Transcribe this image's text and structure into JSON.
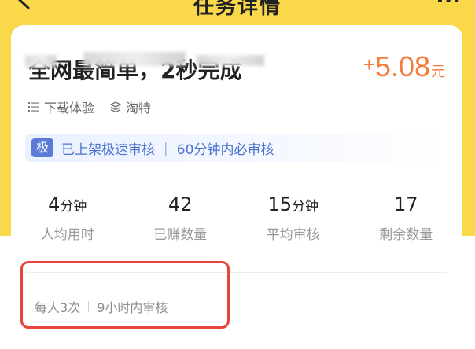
{
  "header": {
    "title": "任务详情",
    "back_icon": "back-chevron-icon",
    "more_icon": "more-dots-icon"
  },
  "task": {
    "title": "全网最简单，2秒完成",
    "price_prefix": "+",
    "price": "5.08",
    "price_unit": "元",
    "tags": [
      {
        "icon": "list-icon",
        "label": "下载体验"
      },
      {
        "icon": "layers-icon",
        "label": "淘特"
      }
    ]
  },
  "notice": {
    "badge": "极",
    "text": "已上架极速审核 ｜ 60分钟内必审核"
  },
  "stats": [
    {
      "value": "4",
      "unit": "分钟",
      "label": "人均用时"
    },
    {
      "value": "42",
      "unit": "",
      "label": "已赚数量"
    },
    {
      "value": "15",
      "unit": "分钟",
      "label": "平均审核"
    },
    {
      "value": "17",
      "unit": "",
      "label": "剩余数量"
    }
  ],
  "limits": {
    "per_person": "每人3次",
    "review_time": "9小时内审核"
  },
  "colors": {
    "background_yellow": "#f9d84a",
    "price_orange": "#f47b3a",
    "notice_blue": "#4a73d0",
    "highlight_red": "#e5453a"
  }
}
